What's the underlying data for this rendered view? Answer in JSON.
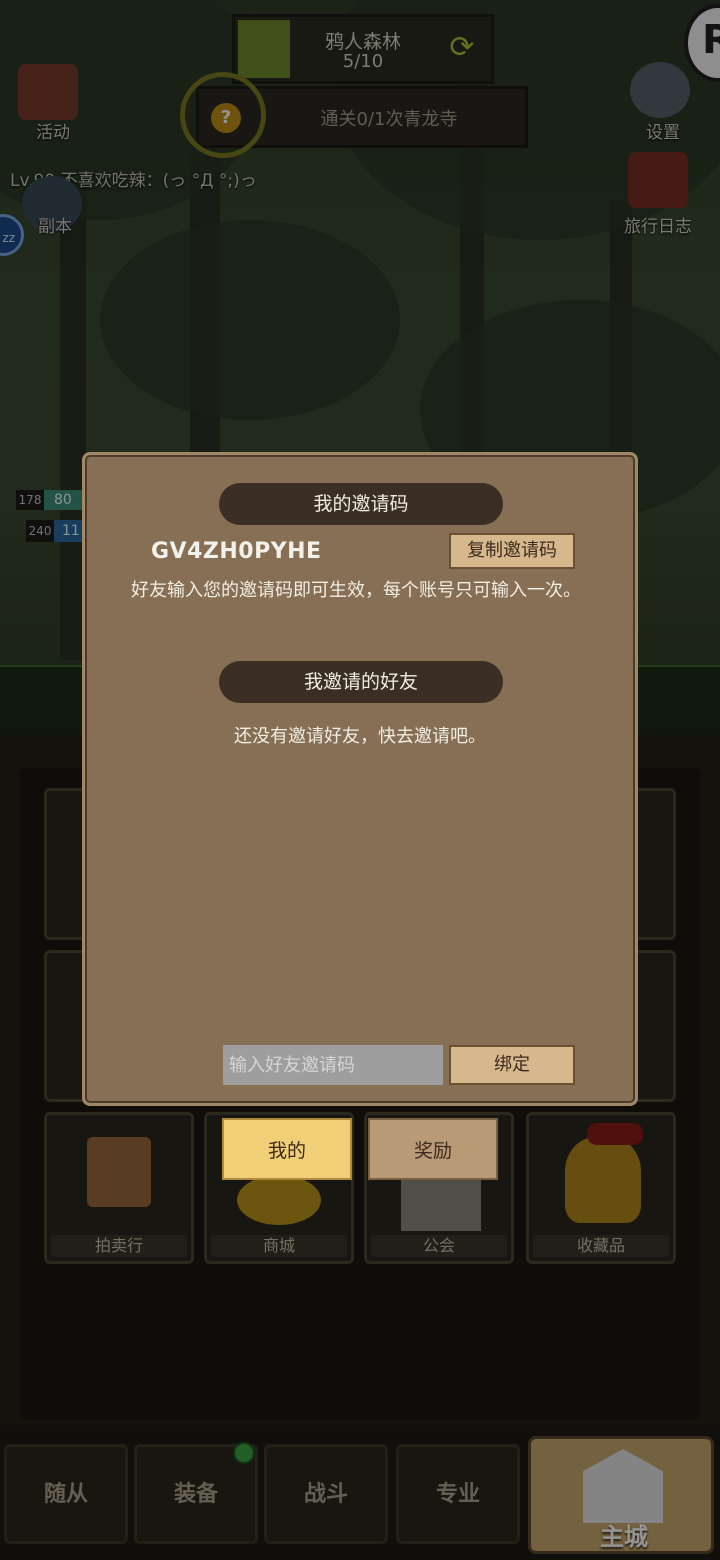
{
  "hud": {
    "stage_title": "鸦人森林",
    "stage_count": "5/10",
    "quest_text": "通关0/1次青龙寺",
    "player_line": "Lv.90 不喜欢吃辣：(っ °Д °;)っ",
    "corner_badge": "R",
    "zz_badge": "zz",
    "left_items": [
      "活动",
      "副本"
    ],
    "right_items": [
      "设置",
      "旅行日志"
    ],
    "hp_values": [
      "178",
      "80",
      "240",
      "11"
    ]
  },
  "grid": {
    "labels": [
      "拍卖行",
      "商城",
      "公会",
      "收藏品"
    ]
  },
  "nav": {
    "items": [
      "随从",
      "装备",
      "战斗",
      "专业"
    ],
    "main": "主城"
  },
  "modal": {
    "my_code_title": "我的邀请码",
    "code": "GV4ZH0PYHE",
    "copy_button": "复制邀请码",
    "description": "好友输入您的邀请码即可生效，每个账号只可输入一次。",
    "friends_title": "我邀请的好友",
    "empty_text": "还没有邀请好友，快去邀请吧。",
    "input_placeholder": "输入好友邀请码",
    "bind_button": "绑定"
  },
  "tabs": {
    "mine": "我的",
    "reward": "奖励"
  }
}
